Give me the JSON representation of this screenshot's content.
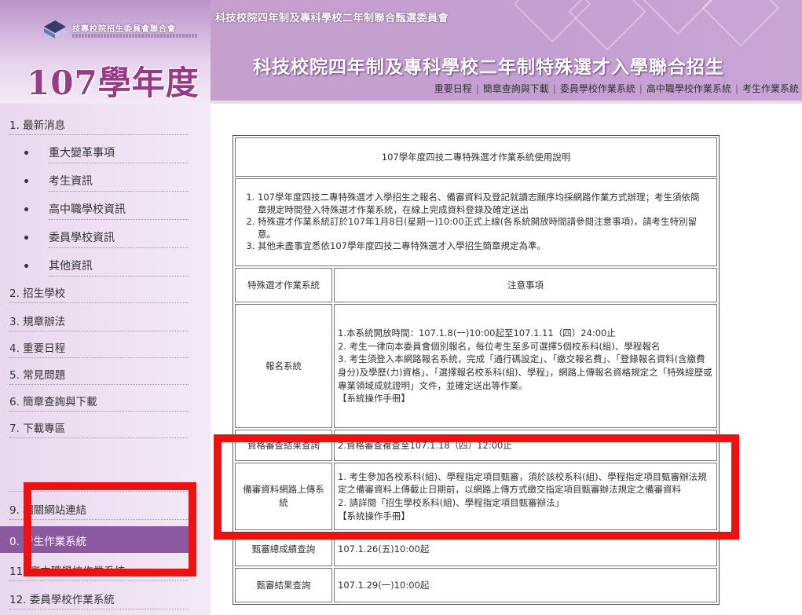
{
  "logo": {
    "org_name": "技專校院招生委員會聯合會",
    "year_title": "107學年度"
  },
  "header": {
    "small_title": "科技校院四年制及專科學校二年制聯合甄選委員會",
    "big_title": "科技校院四年制及專科學校二年制特殊選才入學聯合招生",
    "links": [
      "重要日程",
      "簡章查詢與下載",
      "委員學校作業系統",
      "高中職學校作業系統",
      "考生作業系統"
    ],
    "separator": "|"
  },
  "sidebar": {
    "items": [
      {
        "text": "1.  最新消息",
        "type": "top"
      },
      {
        "text": "重大變革事項",
        "type": "sub"
      },
      {
        "text": "考生資訊",
        "type": "sub"
      },
      {
        "text": "高中職學校資訊",
        "type": "sub"
      },
      {
        "text": "委員學校資訊",
        "type": "sub"
      },
      {
        "text": "其他資訊",
        "type": "sub"
      },
      {
        "text": "2.  招生學校",
        "type": "top"
      },
      {
        "text": "3.  規章辦法",
        "type": "top"
      },
      {
        "text": "4.  重要日程",
        "type": "top"
      },
      {
        "text": "5.  常見問題",
        "type": "top"
      },
      {
        "text": "6.  簡章查詢與下載",
        "type": "top"
      },
      {
        "text": "7.  下載專區",
        "type": "top"
      },
      {
        "text": "",
        "type": "top"
      },
      {
        "text": "9.  相關網站連結",
        "type": "top"
      },
      {
        "text": "0.  考生作業系統",
        "type": "top",
        "active": true
      },
      {
        "text": "11.  高中職學校作業系統",
        "type": "top"
      },
      {
        "text": "12.  委員學校作業系統",
        "type": "top"
      }
    ]
  },
  "table": {
    "title": "107學年度四技二專特殊選才作業系統使用說明",
    "instructions": [
      "107學年度四技二專特殊選才入學招生之報名、備審資料及登記就讀志願序均採網路作業方式辦理；考生須依簡章規定時間登入特殊選才作業系統，在線上完成資料登錄及確定送出",
      "特殊選才作業系統訂於107年1月8日(星期一)10:00正式上線(各系統開放時間請參閱注意事項)，請考生特別留意。",
      "其他未盡事宜悉依107學年度四技二專特殊選才入學招生簡章規定為準。"
    ],
    "header_left": "特殊選才作業系統",
    "header_right": "注意事項",
    "rows": [
      {
        "label": "報名系統",
        "lines": [
          "1.本系統開放時間：107.1.8(一)10:00起至107.1.11（四）24:00止",
          "2. 考生一律向本委員會個別報名，每位考生至多可選擇5個校系科(組)、學程報名",
          "3. 考生須登入本網路報名系統，完成「通行碼設定」、「繳交報名費」、「登錄報名資料(含繳費身分)及學歷(力)資格」、「選擇報名校系科(組)、學程」，網路上傳報名資格規定之「特殊經歷或專業領域成就證明」文件，並確定送出等作業。",
          "【系統操作手冊】"
        ]
      },
      {
        "label": "資格審查結果查詢",
        "lines": [
          "2.資格審查複查至107.1.18（四）12:00止"
        ]
      },
      {
        "label": "備審資料網路上傳系統",
        "lines": [
          "1. 考生參加各校系科(組)、學程指定項目甄審，須於該校系科(組)、學程指定項目甄審辦法規定之備審資料上傳截止日期前，以網路上傳方式繳交指定項目甄審辦法規定之備審資料",
          "2. 請詳閱「招生學校系科(組)、學程指定項目甄審辦法」",
          "【系統操作手冊】"
        ]
      },
      {
        "label": "甄審總成績查詢",
        "lines": [
          "107.1.26(五)10:00起"
        ]
      },
      {
        "label": "甄審結果查詢",
        "lines": [
          "107.1.29(一)10:00起"
        ]
      }
    ]
  },
  "colors": {
    "header_purple": "#c49fd2",
    "sidebar_bg": "#e9d8ee",
    "active_item": "#8b59a0",
    "highlight_red": "#ee1111",
    "year_title": "#9a3a86"
  }
}
